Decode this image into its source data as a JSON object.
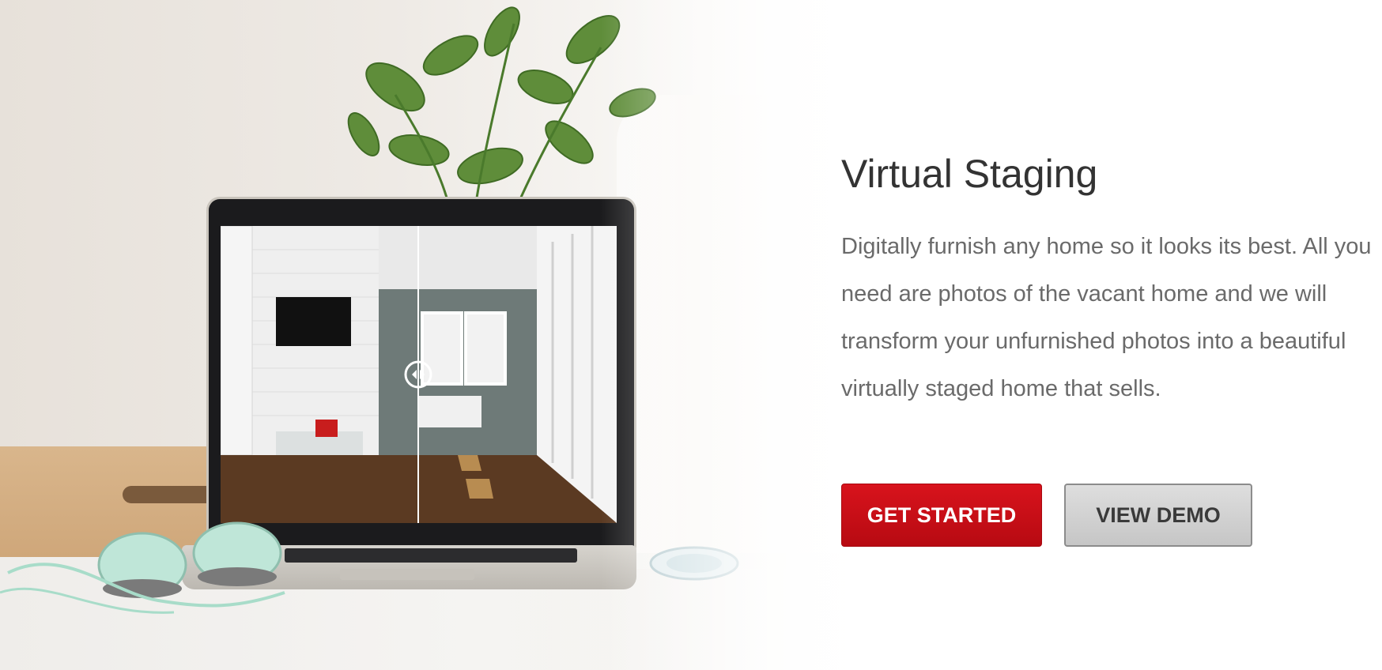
{
  "hero": {
    "title": "Virtual Staging",
    "description": "Digitally furnish any home so it looks its best. All you need are photos of the vacant home and we will transform your unfurnished photos into a beautiful virtually staged home that sells.",
    "buttons": {
      "primary_label": "GET STARTED",
      "secondary_label": "VIEW DEMO"
    }
  },
  "illustration": {
    "icons": [
      "plant-icon",
      "laptop-icon",
      "headphones-icon",
      "before-after-slider-handle-icon"
    ],
    "colors": {
      "primary_button": "#c8101a",
      "secondary_button": "#d3d3d3",
      "title_text": "#333333",
      "body_text": "#6a6a6a"
    }
  }
}
